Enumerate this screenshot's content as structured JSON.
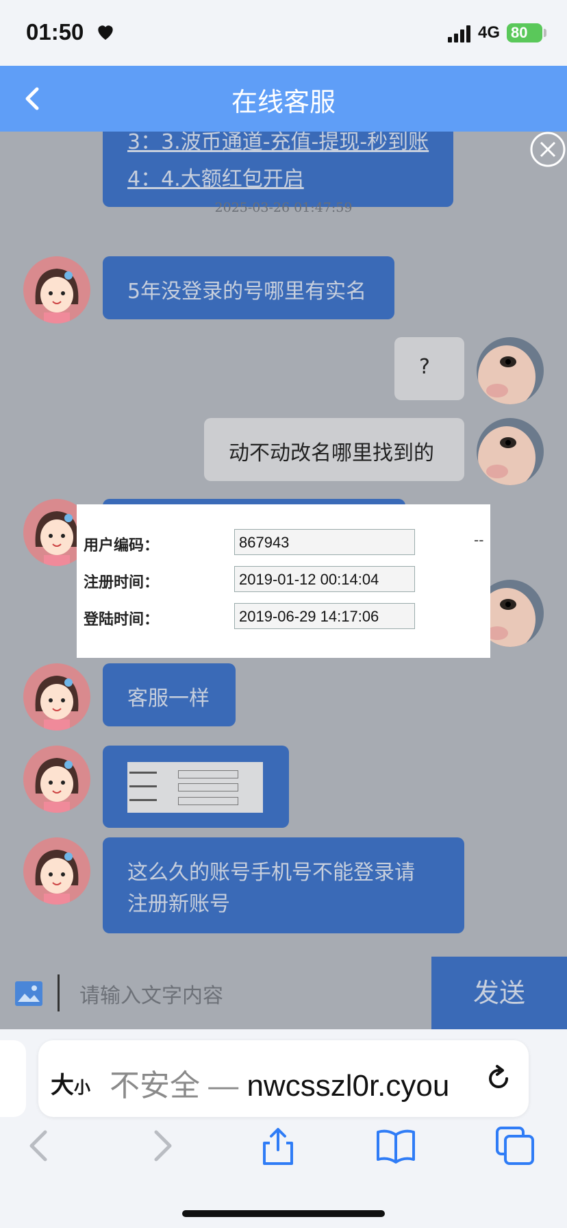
{
  "status_bar": {
    "time": "01:50",
    "network": "4G",
    "battery": "80"
  },
  "header": {
    "title": "在线客服"
  },
  "messages": {
    "top_links": [
      "3：3.波币通道-充值-提现-秒到账",
      "4：4.大额红包开启"
    ],
    "timestamp": "2025-03-26 01:47:59",
    "m1": "5年没登录的号哪里有实名",
    "m2": "?",
    "m3": "动不动改名哪里找到的",
    "m5": "客服一样",
    "m7": "这么久的账号手机号不能登录请",
    "m7b": "注册新账号"
  },
  "account_info": {
    "rows": [
      {
        "label": "用户编码：",
        "value": "867943"
      },
      {
        "label": "注册时间：",
        "value": "2019-01-12 00:14:04"
      },
      {
        "label": "登陆时间：",
        "value": "2019-06-29 14:17:06"
      }
    ],
    "dash": "--"
  },
  "input_bar": {
    "placeholder": "请输入文字内容",
    "send_label": "发送"
  },
  "safari": {
    "text_size": "大",
    "text_size_small": "小",
    "insecure": "不安全 — ",
    "url": "nwcsszl0r.cyou"
  },
  "colors": {
    "header": "#5f9ef7",
    "bubble": "#3a6ab7",
    "backdrop": "#a7abb2"
  }
}
